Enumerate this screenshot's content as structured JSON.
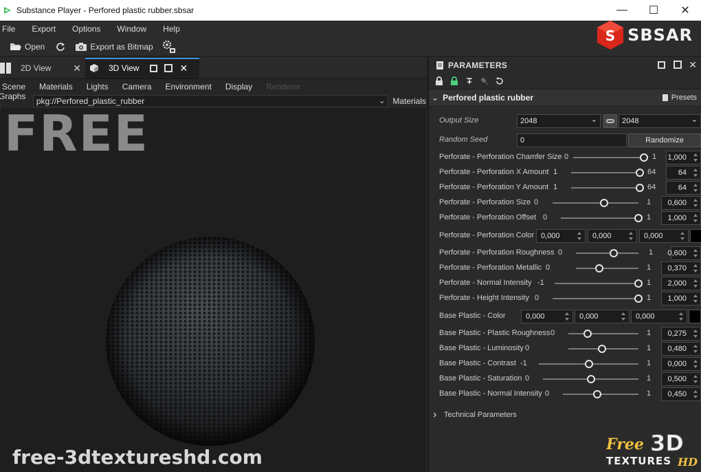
{
  "window": {
    "title": "Substance Player - Perfored plastic rubber.sbsar"
  },
  "menu": [
    "File",
    "Export",
    "Options",
    "Window",
    "Help"
  ],
  "toolbar": {
    "open_label": "Open",
    "export_label": "Export as Bitmap"
  },
  "brand": {
    "sbsar": "SBSAR"
  },
  "tabs": [
    {
      "label": "2D View"
    },
    {
      "label": "3D View"
    }
  ],
  "viewport_menu": [
    "Scene",
    "Materials",
    "Lights",
    "Camera",
    "Environment",
    "Display",
    "Renderer"
  ],
  "graphs": {
    "label": "Graphs :",
    "value": "pkg://Perfored_plastic_rubber",
    "materials_label": "Materials"
  },
  "watermarks": {
    "free": "FREE",
    "site": "free-3dtextureshd.com",
    "logo_free": "Free",
    "logo_3d": "3D",
    "logo_textures": "TEXTURES",
    "logo_hd": "HD"
  },
  "parameters": {
    "header": "PARAMETERS",
    "graph_title": "Perfored plastic rubber",
    "presets_label": "Presets",
    "output_size": {
      "label": "Output Size",
      "width": "2048",
      "height": "2048"
    },
    "random_seed": {
      "label": "Random Seed",
      "value": "0",
      "button": "Randomize"
    },
    "sliders": [
      {
        "label": "Perforate - Perforation Chamfer Size",
        "min": "0",
        "max": "1",
        "value": "1,000",
        "pos": 1.0
      },
      {
        "label": "Perforate - Perforation X Amount",
        "min": "1",
        "max": "64",
        "value": "64",
        "pos": 1.0
      },
      {
        "label": "Perforate - Perforation Y Amount",
        "min": "1",
        "max": "64",
        "value": "64",
        "pos": 1.0
      },
      {
        "label": "Perforate - Perforation Size",
        "min": "0",
        "max": "1",
        "value": "0,600",
        "pos": 0.6
      },
      {
        "label": "Perforate - Perforation Offset",
        "min": "0",
        "max": "1",
        "value": "1,000",
        "pos": 1.0
      }
    ],
    "perf_color": {
      "label": "Perforate - Perforation Color",
      "r": "0,000",
      "g": "0,000",
      "b": "0,000",
      "swatch": "#000000"
    },
    "sliders2": [
      {
        "label": "Perforate - Perforation Roughness",
        "min": "0",
        "max": "1",
        "value": "0,600",
        "pos": 0.6
      },
      {
        "label": "Perforate - Perforation Metallic",
        "min": "0",
        "max": "1",
        "value": "0,370",
        "pos": 0.37
      },
      {
        "label": "Perforate - Normal Intensity",
        "min": "-1",
        "max": "1",
        "value": "2,000",
        "pos": 1.0
      },
      {
        "label": "Perforate - Height Intensity",
        "min": "0",
        "max": "1",
        "value": "1,000",
        "pos": 1.0
      }
    ],
    "base_color": {
      "label": "Base Plastic  - Color",
      "r": "0,000",
      "g": "0,000",
      "b": "0,000",
      "swatch": "#000000"
    },
    "sliders3": [
      {
        "label": "Base Plastic  - Plastic Roughness",
        "min": "0",
        "max": "1",
        "value": "0,275",
        "pos": 0.275
      },
      {
        "label": "Base Plastic  - Luminosity",
        "min": "0",
        "max": "1",
        "value": "0,480",
        "pos": 0.48
      },
      {
        "label": "Base Plastic  - Contrast",
        "min": "-1",
        "max": "1",
        "value": "0,000",
        "pos": 0.5
      },
      {
        "label": "Base Plastic  - Saturation",
        "min": "0",
        "max": "1",
        "value": "0,500",
        "pos": 0.5
      },
      {
        "label": "Base Plastic  - Normal Intensity",
        "min": "0",
        "max": "1",
        "value": "0,450",
        "pos": 0.45
      }
    ],
    "technical": "Technical Parameters"
  }
}
